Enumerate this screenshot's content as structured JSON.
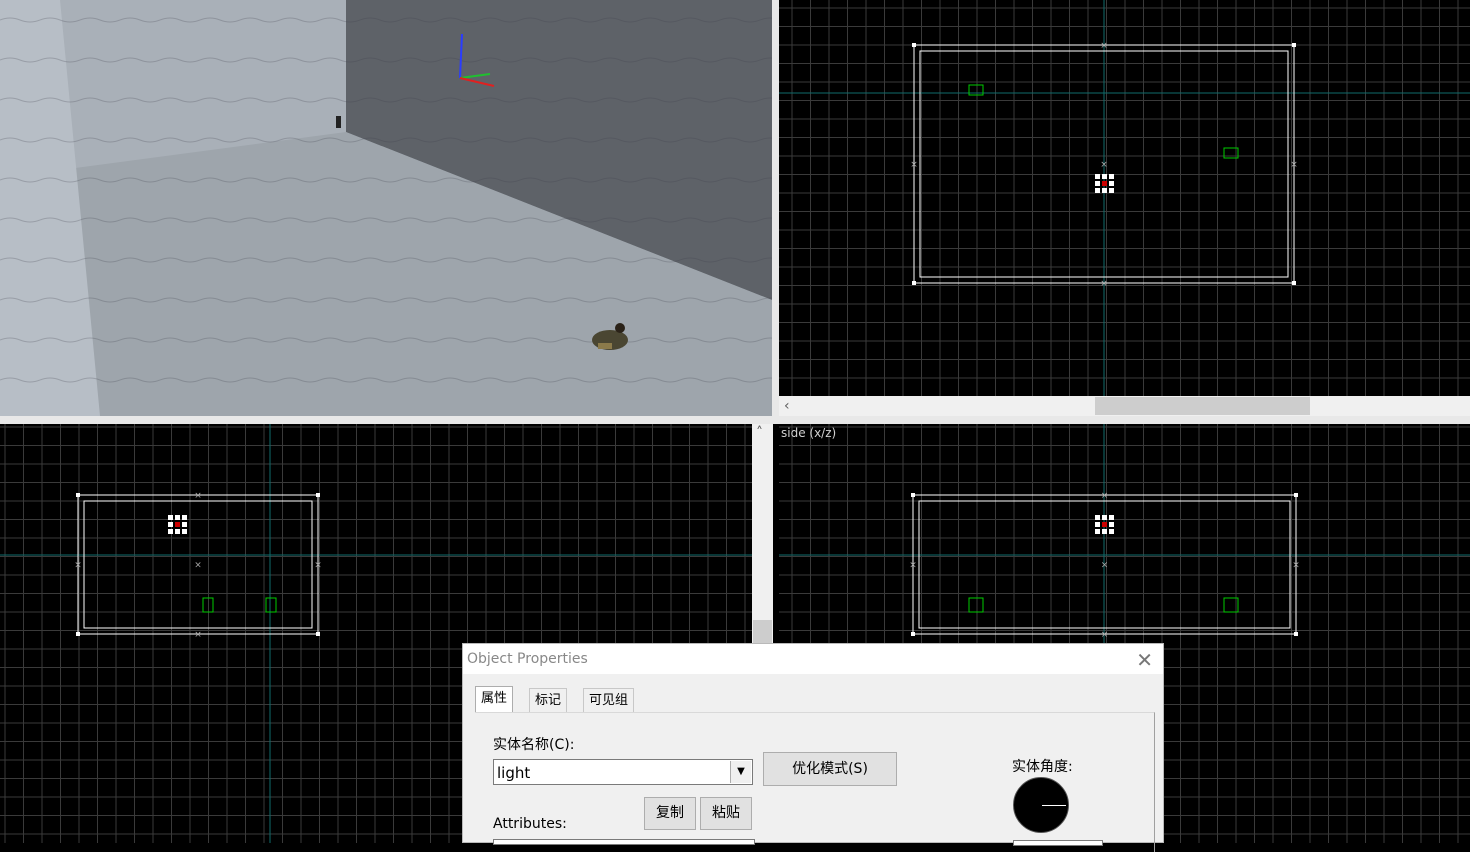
{
  "viewports": {
    "side_label": "side (x/z)"
  },
  "dialog": {
    "title": "Object Properties",
    "tabs": [
      "属性",
      "标记",
      "可见组"
    ],
    "entity_name_label": "实体名称(C):",
    "entity_name_value": "light",
    "smart_edit_button": "优化模式(S)",
    "attributes_label": "Attributes:",
    "copy_button": "复制",
    "paste_button": "粘贴",
    "entity_angle_label": "实体角度:"
  },
  "colors": {
    "grid_line": "#3a3a3a",
    "grid_axis": "#0f6b6b",
    "brush": "#ffffff",
    "light_entity": "#00cc00"
  }
}
